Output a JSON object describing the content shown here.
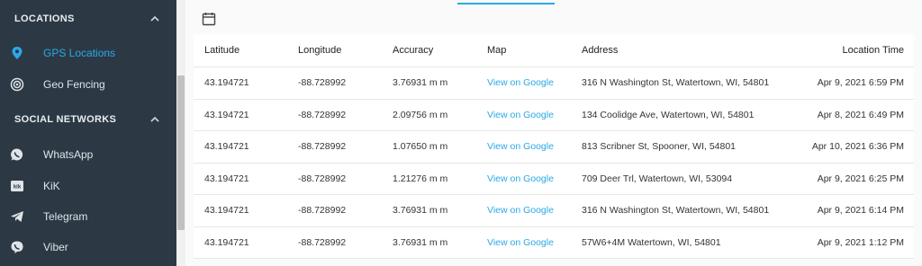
{
  "sidebar": {
    "sections": [
      {
        "title": "LOCATIONS",
        "items": [
          {
            "label": "GPS Locations",
            "icon": "map-pin-icon",
            "active": true
          },
          {
            "label": "Geo Fencing",
            "icon": "target-icon",
            "active": false
          }
        ]
      },
      {
        "title": "SOCIAL NETWORKS",
        "items": [
          {
            "label": "WhatsApp",
            "icon": "whatsapp-icon",
            "active": false
          },
          {
            "label": "KiK",
            "icon": "kik-icon",
            "active": false
          },
          {
            "label": "Telegram",
            "icon": "telegram-icon",
            "active": false
          },
          {
            "label": "Viber",
            "icon": "viber-icon",
            "active": false
          }
        ]
      }
    ]
  },
  "colors": {
    "sidebar_bg": "#2c3945",
    "accent": "#2aa8e8"
  },
  "table": {
    "headers": {
      "latitude": "Latitude",
      "longitude": "Longitude",
      "accuracy": "Accuracy",
      "map": "Map",
      "address": "Address",
      "time": "Location Time"
    },
    "rows": [
      {
        "latitude": "43.194721",
        "longitude": "-88.728992",
        "accuracy": "3.76931 m m",
        "map": "View on Google",
        "address": "316 N Washington St, Watertown, WI, 54801",
        "time": "Apr 9, 2021 6:59 PM"
      },
      {
        "latitude": "43.194721",
        "longitude": "-88.728992",
        "accuracy": "2.09756 m m",
        "map": "View on Google",
        "address": "134 Coolidge Ave, Watertown, WI, 54801",
        "time": "Apr 8, 2021 6:49 PM"
      },
      {
        "latitude": "43.194721",
        "longitude": "-88.728992",
        "accuracy": "1.07650 m m",
        "map": "View on Google",
        "address": "813 Scribner St, Spooner, WI, 54801",
        "time": "Apr 10, 2021 6:36 PM"
      },
      {
        "latitude": "43.194721",
        "longitude": "-88.728992",
        "accuracy": "1.21276 m m",
        "map": "View on Google",
        "address": "709 Deer Trl, Watertown, WI, 53094",
        "time": "Apr 9, 2021 6:25 PM"
      },
      {
        "latitude": "43.194721",
        "longitude": "-88.728992",
        "accuracy": "3.76931 m m",
        "map": "View on Google",
        "address": "316 N Washington St, Watertown, WI, 54801",
        "time": "Apr 9, 2021 6:14 PM"
      },
      {
        "latitude": "43.194721",
        "longitude": "-88.728992",
        "accuracy": "3.76931 m m",
        "map": "View on Google",
        "address": "57W6+4M Watertown, WI, 54801",
        "time": "Apr 9, 2021 1:12 PM"
      }
    ]
  }
}
